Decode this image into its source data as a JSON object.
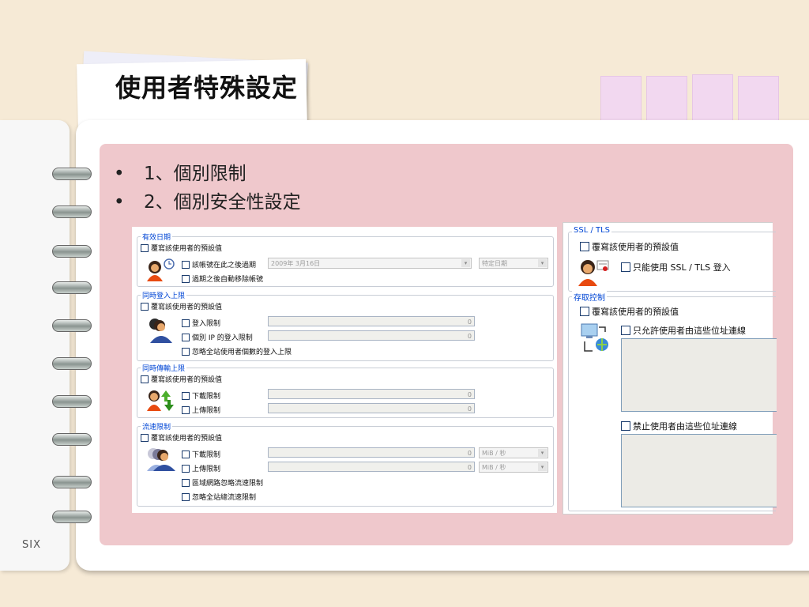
{
  "slide": {
    "title": "使用者特殊設定",
    "bullets": [
      "1、個別限制",
      "2、個別安全性設定"
    ],
    "page_label": "SIX"
  },
  "left_dialog": {
    "expiry": {
      "title": "有效日期",
      "override": "覆寫該使用者的預設值",
      "expire_after": "該帳號在此之後過期",
      "date_value": "2009年 3月16日",
      "date_mode": "特定日期",
      "auto_remove": "過期之後自動移除帳號"
    },
    "concurrent_login": {
      "title": "同時登入上限",
      "override": "覆寫該使用者的預設值",
      "login_limit": "登入限制",
      "login_limit_value": "0",
      "per_ip_limit": "個別 IP 的登入限制",
      "per_ip_value": "0",
      "ignore_global": "忽略全站使用者個數的登入上限"
    },
    "concurrent_transfer": {
      "title": "同時傳輸上限",
      "override": "覆寫該使用者的預設值",
      "download_limit": "下載限制",
      "download_value": "0",
      "upload_limit": "上傳限制",
      "upload_value": "0"
    },
    "speed_limit": {
      "title": "流速限制",
      "override": "覆寫該使用者的預設值",
      "download_limit": "下載限制",
      "download_value": "0",
      "download_unit": "MiB / 秒",
      "upload_limit": "上傳限制",
      "upload_value": "0",
      "upload_unit": "MiB / 秒",
      "lan_ignore": "區域網路忽略流速限制",
      "ignore_global": "忽略全站總流速限制"
    }
  },
  "right_dialog": {
    "ssl": {
      "title": "SSL / TLS",
      "override": "覆寫該使用者的預設值",
      "ssl_only": "只能使用 SSL / TLS 登入"
    },
    "access": {
      "title": "存取控制",
      "override": "覆寫該使用者的預設值",
      "allow_from": "只允許使用者由這些位址連線",
      "deny_from": "禁止使用者由這些位址連線"
    }
  },
  "colors": {
    "background": "#f6ead6",
    "content_panel": "#efc8cc",
    "tabs": "#f2d8f0",
    "groupbox_title": "#0046d5"
  },
  "icons": [
    "user-clock-icon",
    "users-group-icon",
    "user-transfer-icon",
    "users-speed-icon",
    "user-certificate-icon",
    "network-computer-icon"
  ]
}
